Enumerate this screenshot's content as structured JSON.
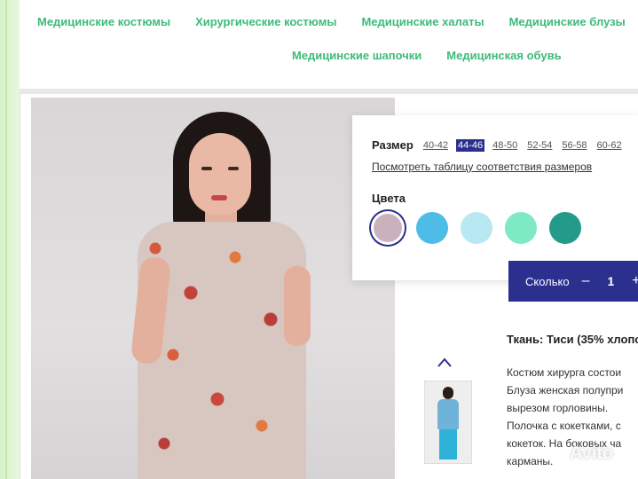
{
  "nav": {
    "row1": [
      "Медицинские костюмы",
      "Хирургические костюмы",
      "Медицинские халаты",
      "Медицинские блузы"
    ],
    "row2": [
      "Медицинские шапочки",
      "Медицинская обувь"
    ]
  },
  "product": {
    "size_label": "Размер",
    "sizes": [
      "40-42",
      "44-46",
      "48-50",
      "52-54",
      "56-58",
      "60-62"
    ],
    "selected_size": "44-46",
    "size_table_link": "Посмотреть таблицу соответствия размеров",
    "colors_label": "Цвета",
    "colors": [
      "#c9b2bc",
      "#4dbce6",
      "#b8e8f2",
      "#7deac3",
      "#249a8a"
    ],
    "selected_color_index": 0,
    "quantity_label": "Сколько",
    "quantity_minus": "–",
    "quantity_value": "1",
    "quantity_plus": "+",
    "fabric": "Ткань: Тиси (35% хлопо",
    "description_lines": [
      "Костюм хирурга состои",
      "Блуза женская полупри",
      "вырезом горловины.",
      "Полочка с кокетками, с",
      "кокеток. На боковых ча",
      "карманы."
    ]
  },
  "watermark": "Avito",
  "accent_color": "#2b2f8e",
  "nav_color": "#3dbb78"
}
